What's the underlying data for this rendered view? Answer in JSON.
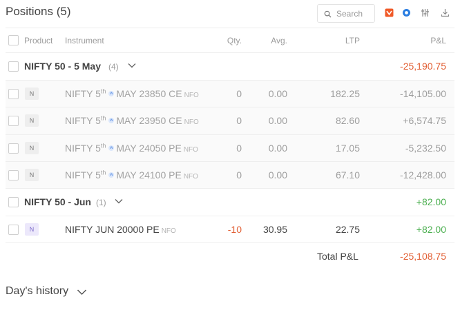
{
  "header": {
    "title": "Positions (5)",
    "search_placeholder": "Search",
    "tools": [
      "analytics-icon",
      "chart-icon",
      "settings-sliders-icon",
      "download-icon"
    ]
  },
  "columns": {
    "product": "Product",
    "instrument": "Instrument",
    "qty": "Qty.",
    "avg": "Avg.",
    "ltp": "LTP",
    "pnl": "P&L"
  },
  "groups": [
    {
      "name": "NIFTY 50 - 5 May",
      "count": "(4)",
      "pnl": "-25,190.75",
      "rows": [
        {
          "product": "N",
          "name_prefix": "NIFTY 5",
          "sup": "th",
          "weekly": "w",
          "name_suffix": "MAY 23850 CE",
          "exchange": "NFO",
          "qty": "0",
          "avg": "0.00",
          "ltp": "182.25",
          "pnl": "-14,105.00"
        },
        {
          "product": "N",
          "name_prefix": "NIFTY 5",
          "sup": "th",
          "weekly": "w",
          "name_suffix": "MAY 23950 CE",
          "exchange": "NFO",
          "qty": "0",
          "avg": "0.00",
          "ltp": "82.60",
          "pnl": "+6,574.75"
        },
        {
          "product": "N",
          "name_prefix": "NIFTY 5",
          "sup": "th",
          "weekly": "w",
          "name_suffix": "MAY 24050 PE",
          "exchange": "NFO",
          "qty": "0",
          "avg": "0.00",
          "ltp": "17.05",
          "pnl": "-5,232.50"
        },
        {
          "product": "N",
          "name_prefix": "NIFTY 5",
          "sup": "th",
          "weekly": "w",
          "name_suffix": "MAY 24100 PE",
          "exchange": "NFO",
          "qty": "0",
          "avg": "0.00",
          "ltp": "67.10",
          "pnl": "-12,428.00"
        }
      ]
    },
    {
      "name": "NIFTY 50 - Jun",
      "count": "(1)",
      "pnl": "+82.00",
      "rows": [
        {
          "product": "N",
          "name": "NIFTY JUN 20000 PE",
          "exchange": "NFO",
          "qty": "-10",
          "avg": "30.95",
          "ltp": "22.75",
          "pnl": "+82.00"
        }
      ]
    }
  ],
  "total": {
    "label": "Total P&L",
    "value": "-25,108.75"
  },
  "history": {
    "label": "Day's history"
  },
  "colors": {
    "loss": "#e25f34",
    "profit": "#4caf50",
    "text": "#444444",
    "muted": "#9b9b9b"
  }
}
